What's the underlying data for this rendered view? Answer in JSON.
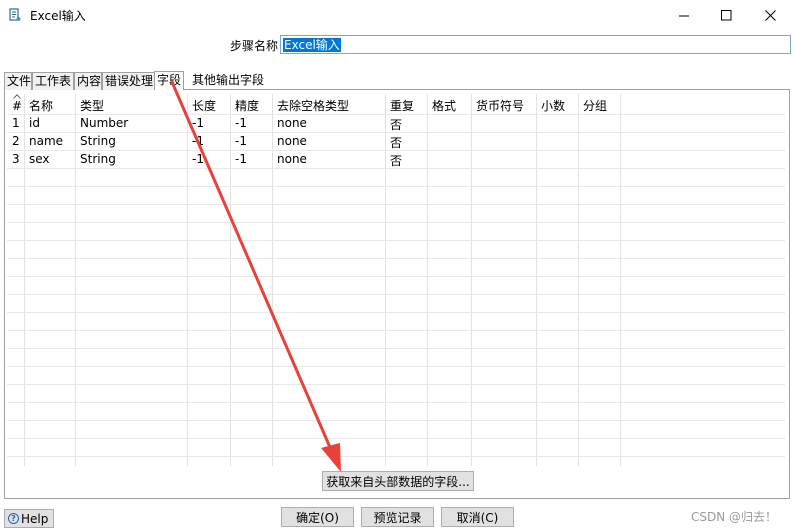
{
  "window": {
    "title": "Excel输入",
    "icon": "kettle-step-icon"
  },
  "step": {
    "label": "步骤名称",
    "value": "Excel输入"
  },
  "tabs": [
    {
      "label": "文件"
    },
    {
      "label": "工作表"
    },
    {
      "label": "内容"
    },
    {
      "label": "错误处理"
    },
    {
      "label": "字段",
      "active": true
    },
    {
      "label": "其他输出字段"
    }
  ],
  "table": {
    "headers": [
      "#",
      "名称",
      "类型",
      "长度",
      "精度",
      "去除空格类型",
      "重复",
      "格式",
      "货币符号",
      "小数",
      "分组"
    ],
    "rows": [
      {
        "num": "1",
        "name": "id",
        "type": "Number",
        "length": "-1",
        "precision": "-1",
        "trim": "none",
        "repeat": "否"
      },
      {
        "num": "2",
        "name": "name",
        "type": "String",
        "length": "-1",
        "precision": "-1",
        "trim": "none",
        "repeat": "否"
      },
      {
        "num": "3",
        "name": "sex",
        "type": "String",
        "length": "-1",
        "precision": "-1",
        "trim": "none",
        "repeat": "否"
      }
    ]
  },
  "buttons": {
    "get_fields": "获取来自头部数据的字段...",
    "ok": "确定(O)",
    "preview": "预览记录",
    "cancel": "取消(C)",
    "help": "Help"
  },
  "watermark": "CSDN @归去！",
  "colors": {
    "annotation_arrow": "#e8403a",
    "selection": "#0078d7"
  }
}
